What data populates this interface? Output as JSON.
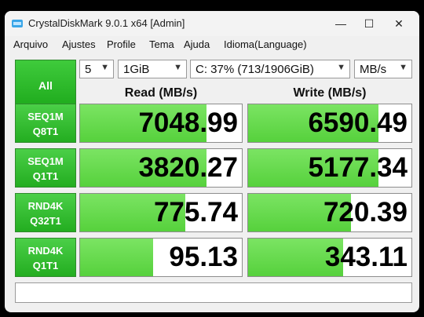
{
  "window": {
    "title": "CrystalDiskMark 9.0.1 x64 [Admin]",
    "controls": {
      "minimize": "—",
      "maximize": "☐",
      "close": "✕"
    }
  },
  "menu": [
    "Arquivo",
    "Ajustes",
    "Profile",
    "Tema",
    "Ajuda",
    "Idioma(Language)"
  ],
  "all_button": {
    "label": "All"
  },
  "settings": {
    "count": "5",
    "size": "1GiB",
    "drive": "C: 37% (713/1906GiB)",
    "unit": "MB/s"
  },
  "headers": {
    "read": "Read (MB/s)",
    "write": "Write (MB/s)"
  },
  "rows": [
    {
      "label1": "SEQ1M",
      "label2": "Q8T1",
      "read": "7048.99",
      "write": "6590.49",
      "read_fill": 0.78,
      "write_fill": 0.8
    },
    {
      "label1": "SEQ1M",
      "label2": "Q1T1",
      "read": "3820.27",
      "write": "5177.34",
      "read_fill": 0.78,
      "write_fill": 0.8
    },
    {
      "label1": "RND4K",
      "label2": "Q32T1",
      "read": "775.74",
      "write": "720.39",
      "read_fill": 0.65,
      "write_fill": 0.63
    },
    {
      "label1": "RND4K",
      "label2": "Q1T1",
      "read": "95.13",
      "write": "343.11",
      "read_fill": 0.45,
      "write_fill": 0.58
    }
  ],
  "comment": "",
  "colors": {
    "accent_green": "#23ad20",
    "bar_green": "#6ddc52",
    "corner_orange": "#f09a1a"
  }
}
